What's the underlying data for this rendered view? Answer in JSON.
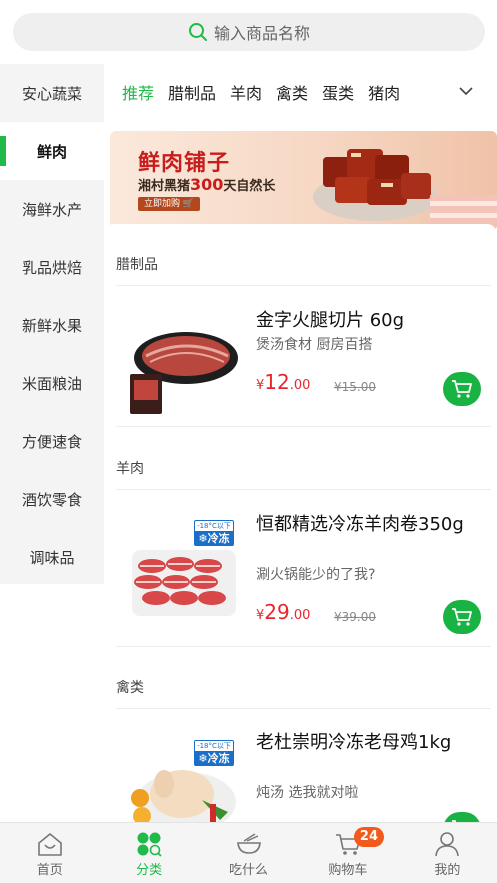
{
  "search": {
    "placeholder": "输入商品名称"
  },
  "sidebar": {
    "items": [
      {
        "label": "安心蔬菜"
      },
      {
        "label": "鲜肉"
      },
      {
        "label": "海鲜水产"
      },
      {
        "label": "乳品烘焙"
      },
      {
        "label": "新鲜水果"
      },
      {
        "label": "米面粮油"
      },
      {
        "label": "方便速食"
      },
      {
        "label": "酒饮零食"
      },
      {
        "label": "调味品"
      }
    ],
    "active_index": 1
  },
  "tabs": {
    "items": [
      {
        "label": "推荐"
      },
      {
        "label": "腊制品"
      },
      {
        "label": "羊肉"
      },
      {
        "label": "禽类"
      },
      {
        "label": "蛋类"
      },
      {
        "label": "猪肉"
      }
    ],
    "active_index": 0
  },
  "banner": {
    "title": "鲜肉铺子",
    "subtitle_prefix": "湘村黑猪",
    "subtitle_highlight": "300",
    "subtitle_suffix": "天自然长",
    "button_label": "立即加购"
  },
  "sections": [
    {
      "title": "腊制品",
      "product": {
        "name": "金字火腿切片 60g",
        "desc": "煲汤食材 厨房百搭",
        "currency": "¥",
        "price_int": "12",
        "price_dec": ".00",
        "old_price": "¥15.00"
      }
    },
    {
      "title": "羊肉",
      "product": {
        "name": "恒都精选冷冻羊肉卷350g",
        "desc": "涮火锅能少的了我?",
        "currency": "¥",
        "price_int": "29",
        "price_dec": ".00",
        "old_price": "¥39.00",
        "tag": "冷冻",
        "tag_temp": "-18°C以下"
      }
    },
    {
      "title": "禽类",
      "product": {
        "name": "老杜崇明冷冻老母鸡1kg",
        "desc": "炖汤 选我就对啦",
        "tag": "冷冻",
        "tag_temp": "-18°C以下"
      }
    }
  ],
  "bottom_nav": {
    "items": [
      {
        "label": "首页",
        "icon": "home-icon"
      },
      {
        "label": "分类",
        "icon": "category-icon"
      },
      {
        "label": "吃什么",
        "icon": "bowl-icon"
      },
      {
        "label": "购物车",
        "icon": "cart-icon"
      },
      {
        "label": "我的",
        "icon": "user-icon"
      }
    ],
    "active_index": 1,
    "cart_badge": "24"
  },
  "colors": {
    "accent": "#1fba4a",
    "price": "#e8262d",
    "badge": "#f25a1b"
  }
}
